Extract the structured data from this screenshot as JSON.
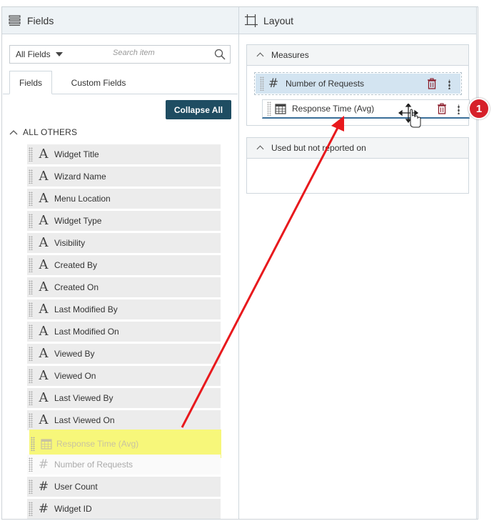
{
  "fields_panel": {
    "title": "Fields",
    "dropdown_value": "All Fields",
    "search_placeholder": "Search item",
    "tabs": [
      {
        "label": "Fields",
        "active": true
      },
      {
        "label": "Custom Fields",
        "active": false
      }
    ],
    "collapse_all_label": "Collapse All",
    "group_label": "ALL OTHERS",
    "items": [
      {
        "label": "Widget Title",
        "icon": "text-icon"
      },
      {
        "label": "Wizard Name",
        "icon": "text-icon"
      },
      {
        "label": "Menu Location",
        "icon": "text-icon"
      },
      {
        "label": "Widget Type",
        "icon": "text-icon"
      },
      {
        "label": "Visibility",
        "icon": "text-icon"
      },
      {
        "label": "Created By",
        "icon": "text-icon"
      },
      {
        "label": "Created On",
        "icon": "text-icon"
      },
      {
        "label": "Last Modified By",
        "icon": "text-icon"
      },
      {
        "label": "Last Modified On",
        "icon": "text-icon"
      },
      {
        "label": "Viewed By",
        "icon": "text-icon"
      },
      {
        "label": "Viewed On",
        "icon": "text-icon"
      },
      {
        "label": "Last Viewed By",
        "icon": "text-icon"
      },
      {
        "label": "Last Viewed On",
        "icon": "text-icon"
      },
      {
        "label": "Response Time (Avg)",
        "icon": "calendar-icon"
      },
      {
        "label": "Number of Requests",
        "icon": "hash-icon"
      },
      {
        "label": "User Count",
        "icon": "hash-icon"
      },
      {
        "label": "Widget ID",
        "icon": "hash-icon"
      }
    ]
  },
  "layout_panel": {
    "title": "Layout",
    "measures_label": "Measures",
    "measures": [
      {
        "label": "Number of Requests"
      },
      {
        "label": "Response Time (Avg)"
      }
    ],
    "unused_label": "Used but not reported on"
  },
  "annotation": {
    "step_number": "1",
    "arrow_color": "#e8191d",
    "highlight_color": "#f7f77a"
  },
  "colors": {
    "header_bg": "#eef3f6",
    "button_bg": "#1f4d62",
    "measure_highlight": "#d3e4f1"
  }
}
